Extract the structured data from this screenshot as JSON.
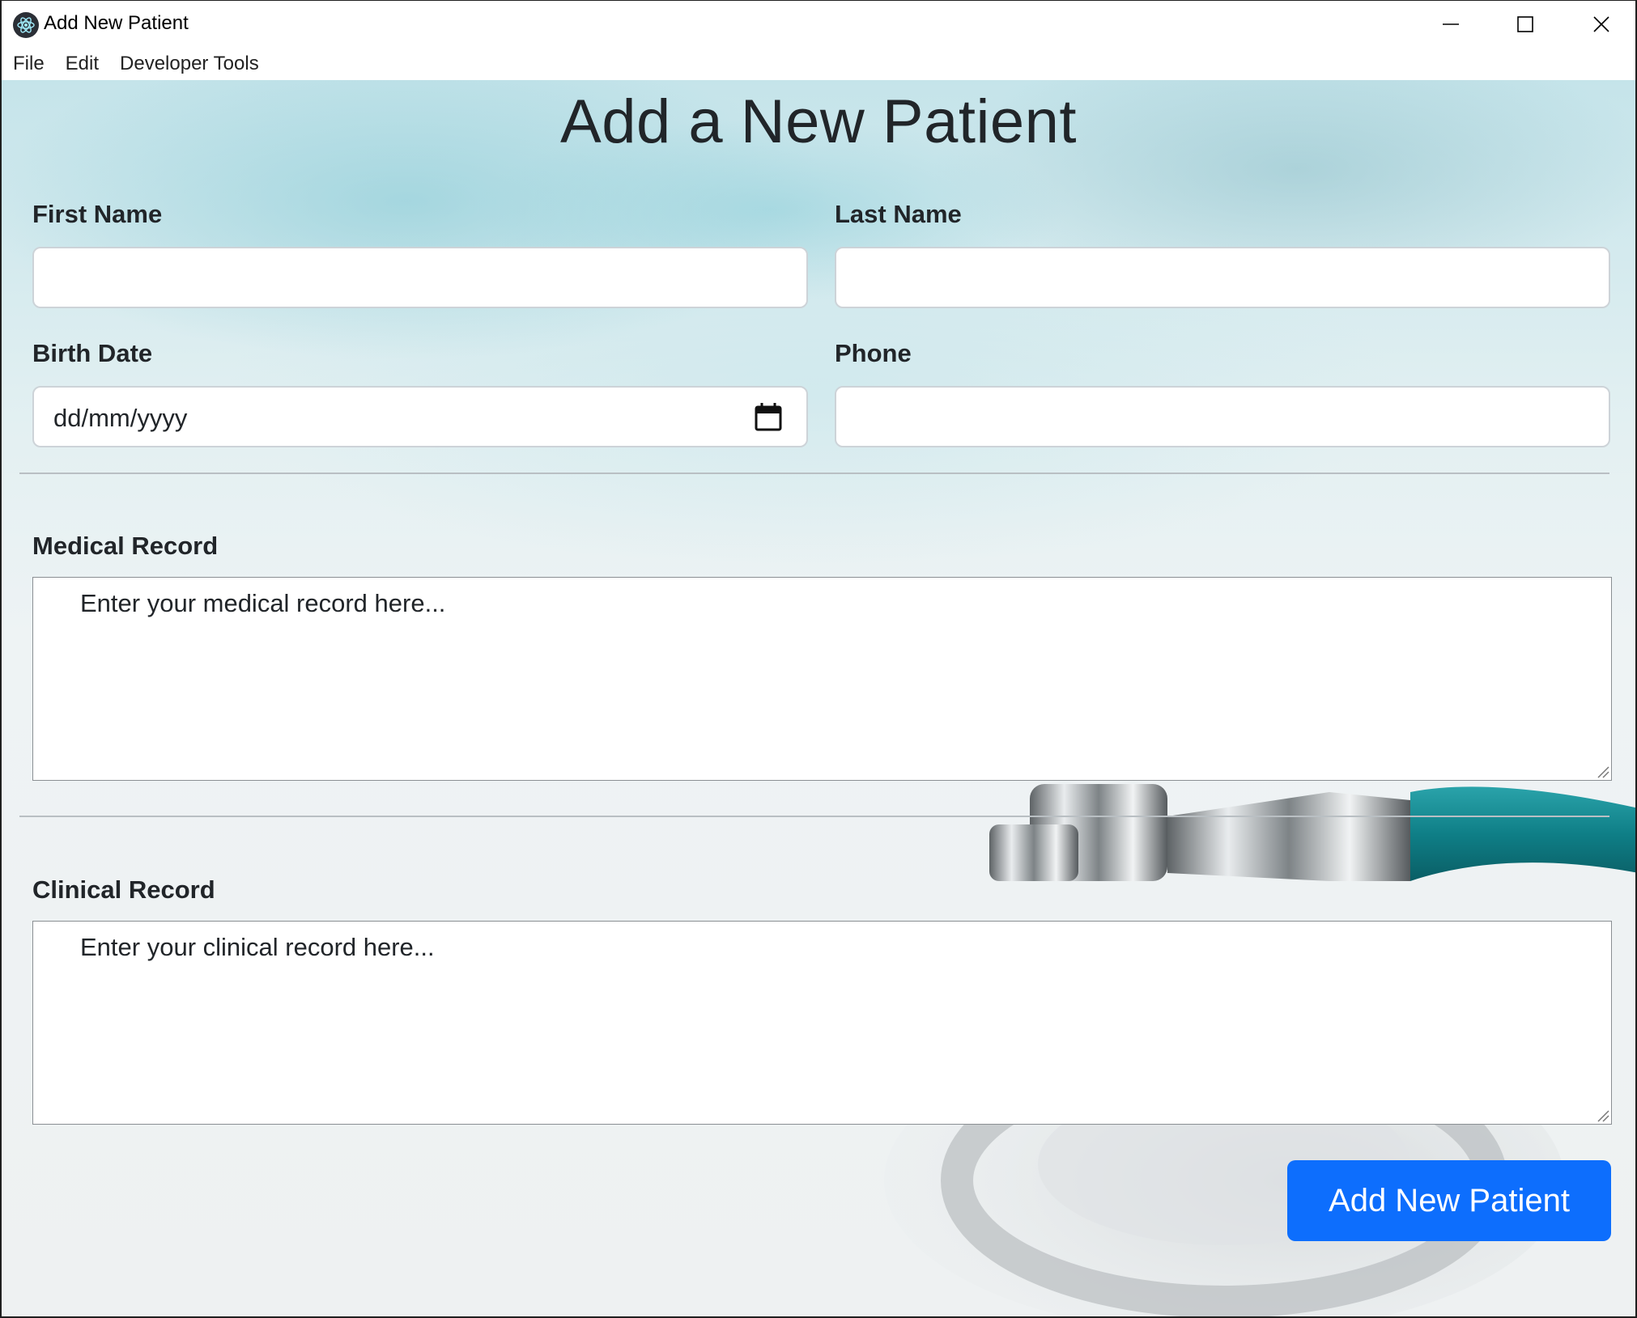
{
  "window": {
    "title": "Add New Patient",
    "icon": "electron-app-icon"
  },
  "menu": {
    "items": [
      "File",
      "Edit",
      "Developer Tools"
    ]
  },
  "page": {
    "title": "Add a New Patient"
  },
  "form": {
    "first_name": {
      "label": "First Name",
      "value": ""
    },
    "last_name": {
      "label": "Last Name",
      "value": ""
    },
    "birth_date": {
      "label": "Birth Date",
      "placeholder": "dd/mm/yyyy"
    },
    "phone": {
      "label": "Phone",
      "value": ""
    },
    "medical_record": {
      "label": "Medical Record",
      "placeholder": "Enter your medical record here..."
    },
    "clinical_record": {
      "label": "Clinical Record",
      "placeholder": "Enter your clinical record here..."
    },
    "submit_label": "Add New Patient"
  },
  "colors": {
    "primary": "#0d6efd",
    "text": "#212529"
  }
}
